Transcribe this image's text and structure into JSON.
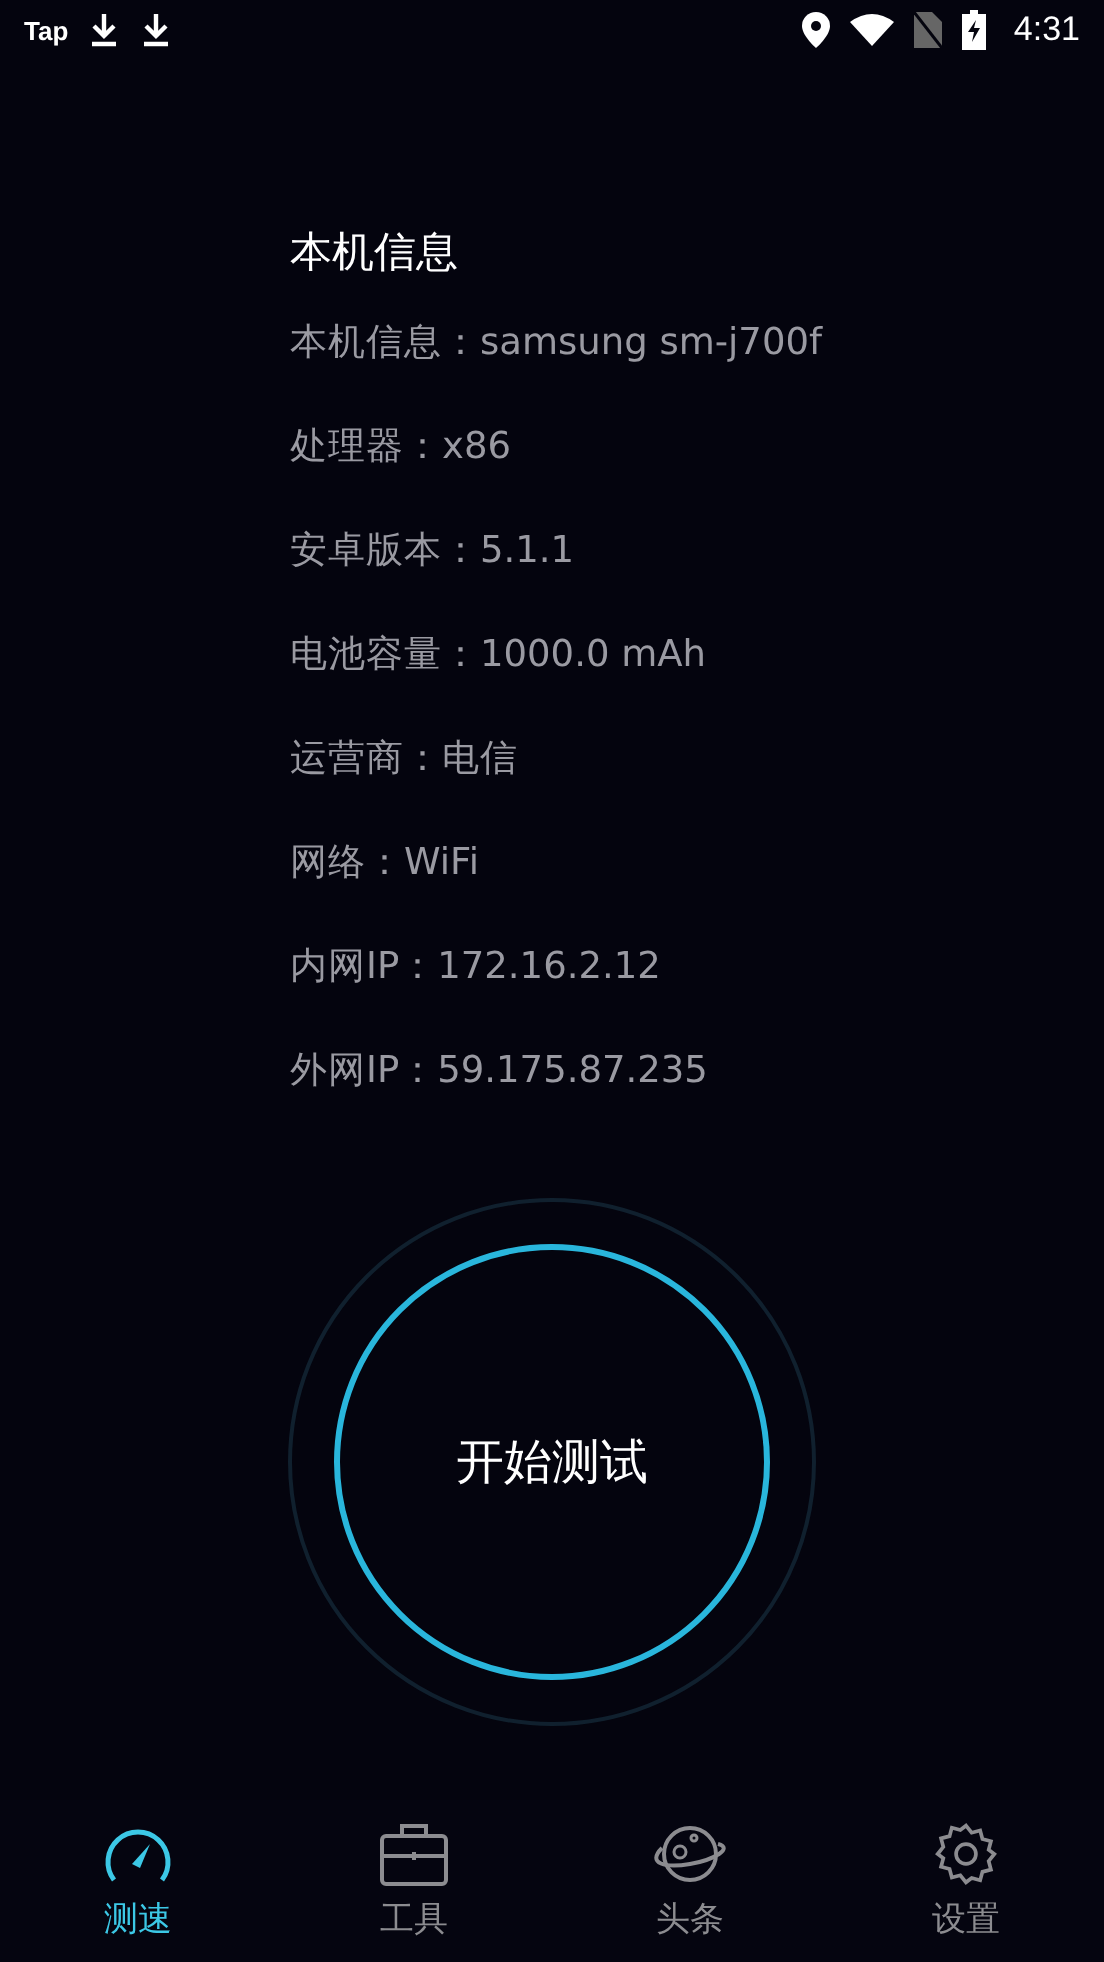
{
  "status_bar": {
    "app_label": "Tap",
    "time": "4:31"
  },
  "info": {
    "title": "本机信息",
    "rows": [
      "本机信息：samsung sm-j700f",
      "处理器：x86",
      "安卓版本：5.1.1",
      "电池容量：1000.0 mAh",
      "运营商：电信",
      "网络：WiFi",
      "内网IP：172.16.2.12",
      "外网IP：59.175.87.235"
    ]
  },
  "start_button": {
    "label": "开始测试"
  },
  "nav": [
    {
      "label": "测速",
      "selected": true
    },
    {
      "label": "工具",
      "selected": false
    },
    {
      "label": "头条",
      "selected": false
    },
    {
      "label": "设置",
      "selected": false
    }
  ]
}
